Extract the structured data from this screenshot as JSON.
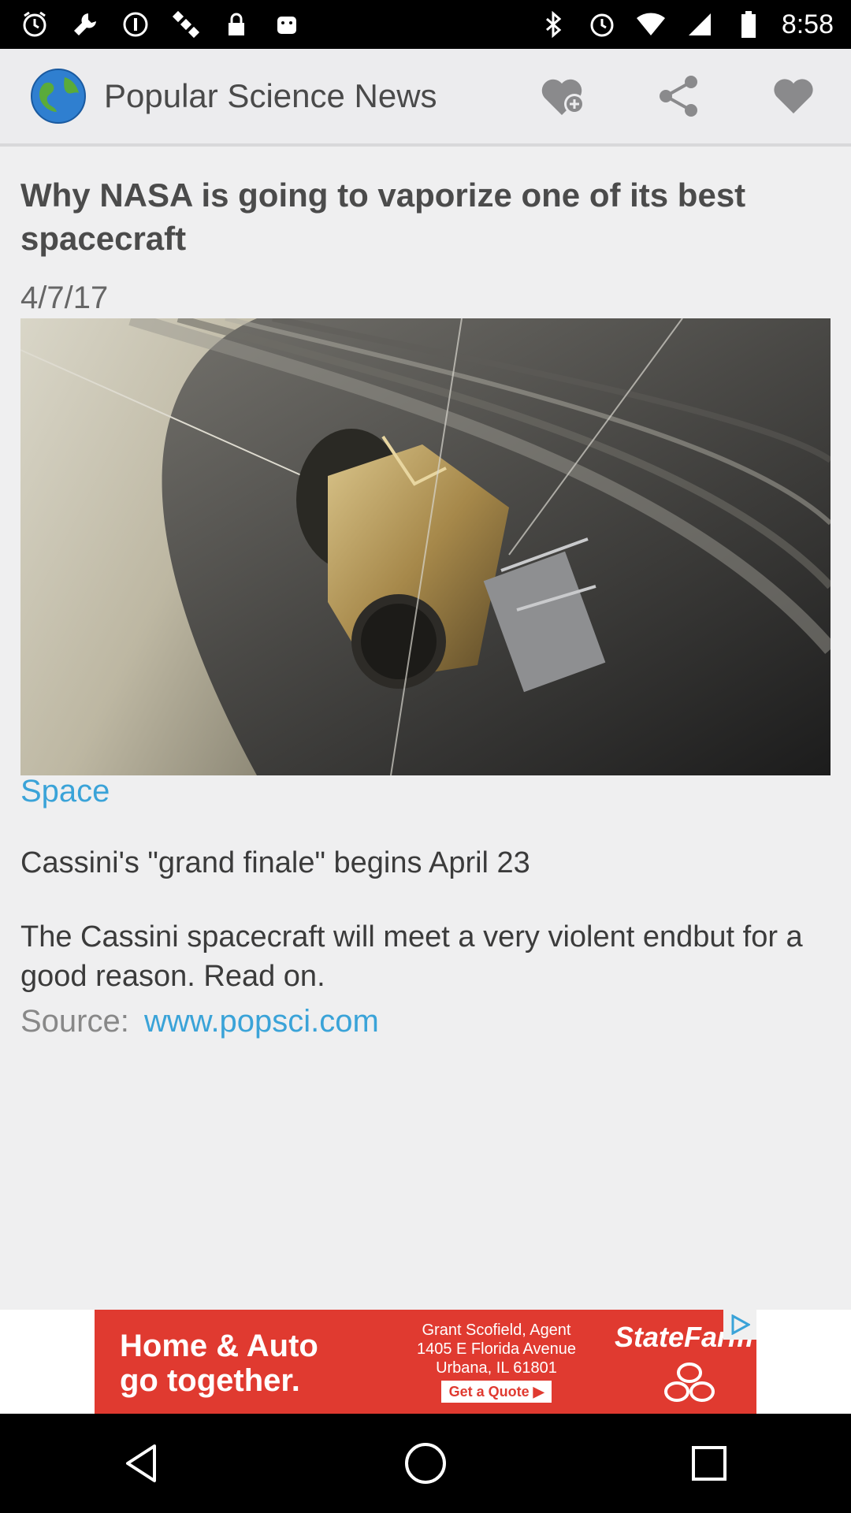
{
  "status_bar": {
    "time": "8:58",
    "left_icons": [
      "alarm-icon",
      "wrench-icon",
      "info-icon",
      "satellite-icon",
      "lock-icon",
      "android-icon"
    ],
    "right_icons": [
      "bluetooth-icon",
      "alarm-icon",
      "wifi-icon",
      "signal-icon",
      "battery-icon"
    ]
  },
  "app_bar": {
    "title": "Popular Science News",
    "actions": [
      "favorite-add-icon",
      "share-icon",
      "heart-icon"
    ]
  },
  "article": {
    "headline": "Why NASA is going to vaporize one of its best spacecraft",
    "date": "4/7/17",
    "category": "Space",
    "subtitle": "Cassini's \"grand finale\" begins April 23",
    "summary": "The Cassini spacecraft will meet a very violent endbut for a good reason. Read on.",
    "source_label": "Source:",
    "source_link": "www.popsci.com"
  },
  "ad": {
    "headline_line1": "Home & Auto",
    "headline_line2": "go together.",
    "agent_line1": "Grant Scofield, Agent",
    "agent_line2": "1405 E Florida Avenue",
    "agent_line3": "Urbana, IL 61801",
    "cta": "Get a Quote ▶",
    "brand": "StateFarm"
  },
  "colors": {
    "accent_link": "#3aa3d8",
    "ad_red": "#e03a30",
    "appbar_bg": "#ececee"
  }
}
